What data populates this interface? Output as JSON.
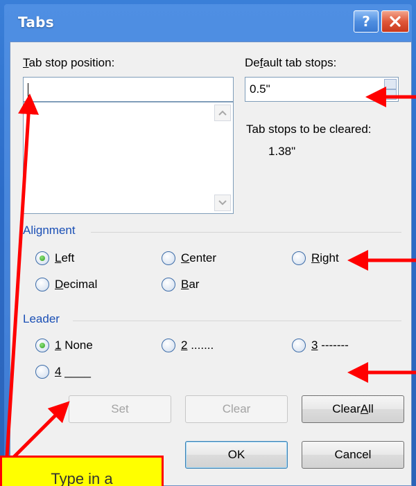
{
  "window": {
    "title": "Tabs",
    "help_glyph": "?",
    "close_icon": "close-icon"
  },
  "tab_stop": {
    "label_prefix": "",
    "label_hotkey": "T",
    "label_rest": "ab stop position:",
    "value": "",
    "list_items": []
  },
  "default_tabs": {
    "label_prefix": "De",
    "label_hotkey": "f",
    "label_rest": "ault tab stops:",
    "value": "0.5\""
  },
  "cleared": {
    "label": "Tab stops to be cleared:",
    "value": "1.38\""
  },
  "alignment": {
    "title": "Alignment",
    "options": [
      {
        "hotkey": "L",
        "rest": "eft",
        "checked": true
      },
      {
        "hotkey": "C",
        "rest": "enter",
        "checked": false
      },
      {
        "hotkey": "R",
        "rest": "ight",
        "checked": false
      },
      {
        "hotkey": "D",
        "rest": "ecimal",
        "checked": false
      },
      {
        "hotkey": "B",
        "rest": "ar",
        "checked": false
      }
    ]
  },
  "leader": {
    "title": "Leader",
    "options": [
      {
        "hotkey": "1",
        "rest": " None",
        "checked": true
      },
      {
        "hotkey": "2",
        "rest": " .......",
        "checked": false
      },
      {
        "hotkey": "3",
        "rest": " -------",
        "checked": false
      },
      {
        "hotkey": "4",
        "rest": " ____",
        "checked": false
      }
    ]
  },
  "buttons": {
    "set": "Set",
    "clear": "Clear",
    "clear_all_prefix": "Clear ",
    "clear_all_hotkey": "A",
    "clear_all_rest": "ll",
    "ok": "OK",
    "cancel": "Cancel"
  },
  "annotation": {
    "callout_text": "Type in a",
    "arrow_color": "#ff0000",
    "callout_bg": "#ffff00"
  },
  "colors": {
    "frame_blue": "#2c6cc8",
    "section_title": "#1a4fb5",
    "dialog_bg": "#f0f0f0"
  }
}
